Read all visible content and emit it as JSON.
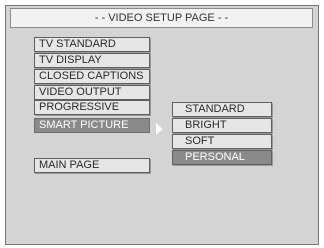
{
  "header": {
    "title": "- - VIDEO SETUP PAGE - -"
  },
  "menu": {
    "items": [
      {
        "label": "TV STANDARD"
      },
      {
        "label": "TV DISPLAY"
      },
      {
        "label": "CLOSED CAPTIONS"
      },
      {
        "label": "VIDEO OUTPUT"
      },
      {
        "label": "PROGRESSIVE"
      },
      {
        "label": "SMART PICTURE",
        "selected": true
      }
    ],
    "main_page": "MAIN PAGE"
  },
  "submenu": {
    "items": [
      {
        "label": "STANDARD"
      },
      {
        "label": "BRIGHT"
      },
      {
        "label": "SOFT"
      },
      {
        "label": "PERSONAL",
        "selected": true
      }
    ]
  },
  "colors": {
    "background": "#d4d4d4",
    "item": "#e6e6e6",
    "selected": "#8a8a8a",
    "selected_text": "#ffffff"
  },
  "icons": {
    "submenu_arrow": "chevron-right-icon"
  }
}
